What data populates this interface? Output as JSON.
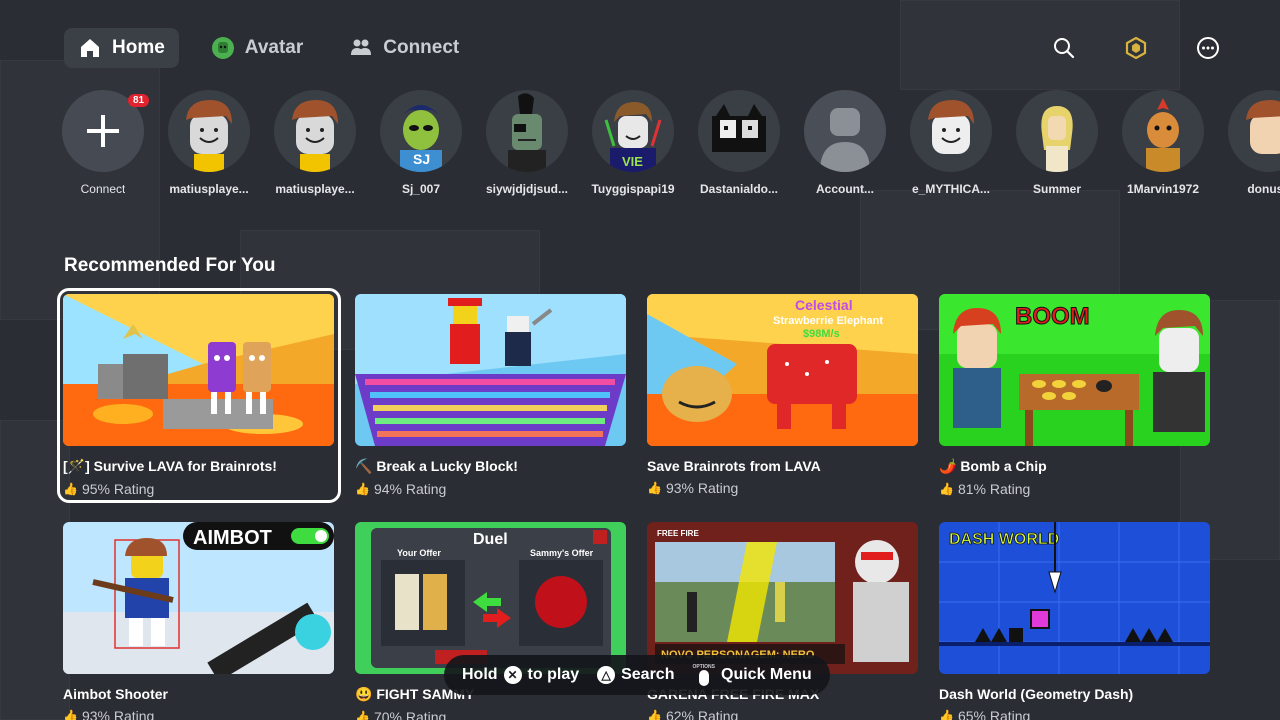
{
  "nav": {
    "tabs": [
      {
        "label": "Home",
        "icon": "home-icon",
        "active": true
      },
      {
        "label": "Avatar",
        "icon": "avatar-icon",
        "active": false
      },
      {
        "label": "Connect",
        "icon": "people-icon",
        "active": false
      }
    ],
    "right_icons": [
      "search-icon",
      "robux-icon",
      "more-icon"
    ]
  },
  "friends": {
    "connect_label": "Connect",
    "badge_count": "81",
    "items": [
      {
        "name": "matiusplaye..."
      },
      {
        "name": "matiusplaye..."
      },
      {
        "name": "Sj_007"
      },
      {
        "name": "siywjdjdjsud..."
      },
      {
        "name": "Tuyggispapi19"
      },
      {
        "name": "Dastanialdo..."
      },
      {
        "name": "Account..."
      },
      {
        "name": "e_MYTHICA..."
      },
      {
        "name": "Summer"
      },
      {
        "name": "1Marvin1972"
      },
      {
        "name": "donusfi"
      }
    ]
  },
  "section": {
    "title": "Recommended For You"
  },
  "games": [
    {
      "title": "[🪄] Survive LAVA for Brainrots!",
      "rating": "95% Rating"
    },
    {
      "title": "⛏️ Break a Lucky Block!",
      "rating": "94% Rating"
    },
    {
      "title": "Save Brainrots from LAVA",
      "rating": "93% Rating"
    },
    {
      "title": "🌶️ Bomb a Chip",
      "rating": "81% Rating"
    },
    {
      "title": "Aimbot Shooter",
      "rating": "93% Rating"
    },
    {
      "title": "😃 FIGHT SAMMY",
      "rating": "70% Rating"
    },
    {
      "title": "GARENA FREE FIRE MAX",
      "rating": "62% Rating"
    },
    {
      "title": "Dash World (Geometry Dash)",
      "rating": "65% Rating"
    }
  ],
  "thumb_text": {
    "celestial": "Celestial",
    "strawberrie": "Strawberrie Elephant",
    "price": "$98M/s",
    "boom": "BOOM",
    "aimbot": "AIMBOT",
    "duel": "Duel",
    "your_offer": "Your Offer",
    "sammys_offer": "Sammy's Offer",
    "freefire": "FREE FIRE",
    "novo": "NOVO PERSONAGEM: NERO",
    "dash": "DASH WORLD"
  },
  "hints": {
    "hold": "Hold",
    "to_play": "to play",
    "search": "Search",
    "quick_menu": "Quick Menu",
    "options": "OPTIONS"
  },
  "colors": {
    "background": "#2a2d33",
    "active_tab": "#3b3f46",
    "badge": "#e0232e",
    "robux": "#d6b340"
  }
}
